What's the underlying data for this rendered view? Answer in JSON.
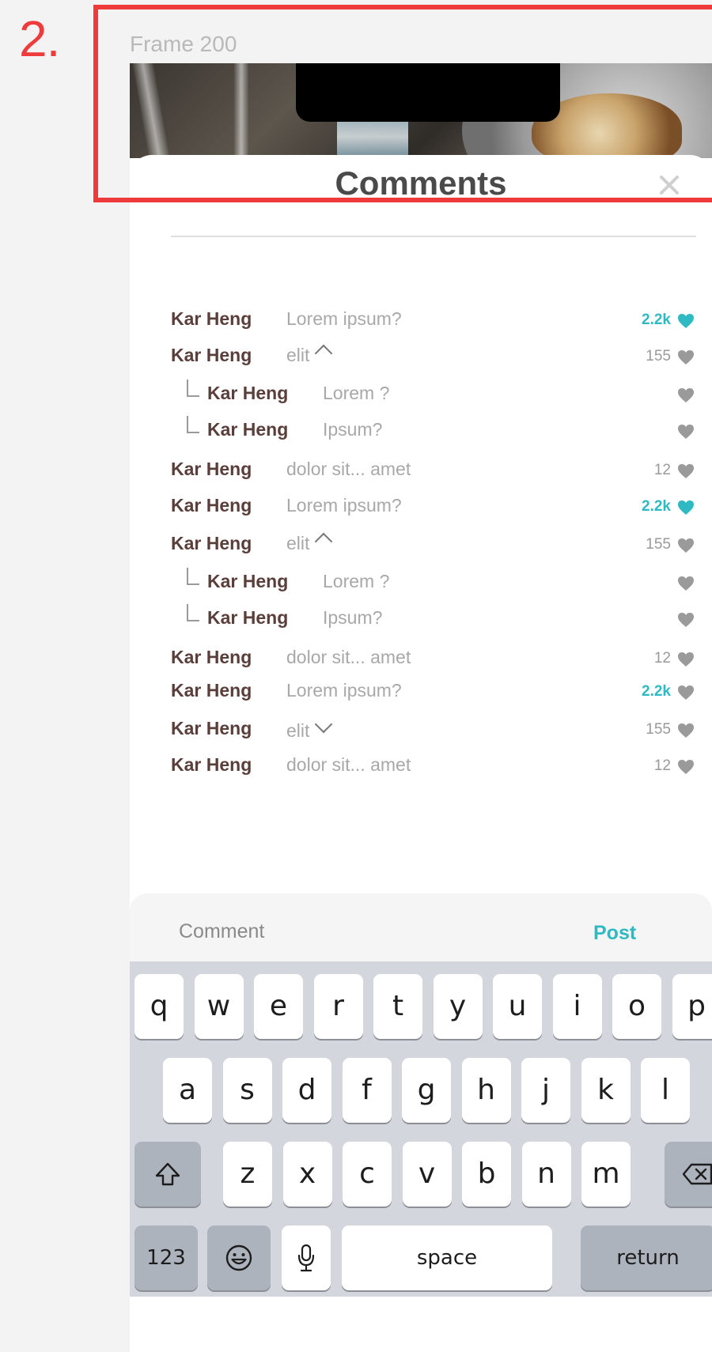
{
  "annotation": {
    "step_label": "2."
  },
  "frame": {
    "label": "Frame 200"
  },
  "sheet": {
    "title": "Comments"
  },
  "comments": [
    {
      "author": "Kar Heng",
      "text": "Lorem ipsum?",
      "count": "2.2k",
      "liked": true,
      "reply": false,
      "chevron": "none"
    },
    {
      "author": "Kar Heng",
      "text": "elit",
      "count": "155",
      "liked": false,
      "reply": false,
      "chevron": "up"
    },
    {
      "author": "Kar Heng",
      "text": "Lorem ?",
      "count": "",
      "liked": false,
      "reply": true,
      "chevron": "none"
    },
    {
      "author": "Kar Heng",
      "text": "Ipsum?",
      "count": "",
      "liked": false,
      "reply": true,
      "chevron": "none"
    },
    {
      "author": "Kar Heng",
      "text": "dolor sit... amet",
      "count": "12",
      "liked": false,
      "reply": false,
      "chevron": "none"
    },
    {
      "author": "Kar Heng",
      "text": "Lorem ipsum?",
      "count": "2.2k",
      "liked": true,
      "reply": false,
      "chevron": "none"
    },
    {
      "author": "Kar Heng",
      "text": "elit",
      "count": "155",
      "liked": false,
      "reply": false,
      "chevron": "up"
    },
    {
      "author": "Kar Heng",
      "text": "Lorem ?",
      "count": "",
      "liked": false,
      "reply": true,
      "chevron": "none"
    },
    {
      "author": "Kar Heng",
      "text": "Ipsum?",
      "count": "",
      "liked": false,
      "reply": true,
      "chevron": "none"
    },
    {
      "author": "Kar Heng",
      "text": "dolor sit... amet",
      "count": "12",
      "liked": false,
      "reply": false,
      "chevron": "none"
    },
    {
      "author": "Kar Heng",
      "text": "Lorem ipsum?",
      "count": "2.2k",
      "liked": false,
      "reply": false,
      "chevron": "none",
      "count_teal": true
    },
    {
      "author": "Kar Heng",
      "text": "elit",
      "count": "155",
      "liked": false,
      "reply": false,
      "chevron": "down"
    },
    {
      "author": "Kar Heng",
      "text": "dolor sit... amet",
      "count": "12",
      "liked": false,
      "reply": false,
      "chevron": "none"
    }
  ],
  "input": {
    "placeholder": "Comment",
    "post_label": "Post"
  },
  "keyboard": {
    "row1": [
      "q",
      "w",
      "e",
      "r",
      "t",
      "y",
      "u",
      "i",
      "o",
      "p"
    ],
    "row2": [
      "a",
      "s",
      "d",
      "f",
      "g",
      "h",
      "j",
      "k",
      "l"
    ],
    "row3": [
      "z",
      "x",
      "c",
      "v",
      "b",
      "n",
      "m"
    ],
    "numbers_label": "123",
    "space_label": "space",
    "return_label": "return",
    "shift_icon": "shift-icon",
    "delete_icon": "backspace-icon",
    "emoji_icon": "emoji-icon",
    "mic_icon": "microphone-icon"
  },
  "colors": {
    "accent": "#2fb9c3",
    "author": "#5a3e3a",
    "muted": "#a8a8a8",
    "heart_gray": "#9a9a9a",
    "annotation_red": "#ee3a3a"
  }
}
